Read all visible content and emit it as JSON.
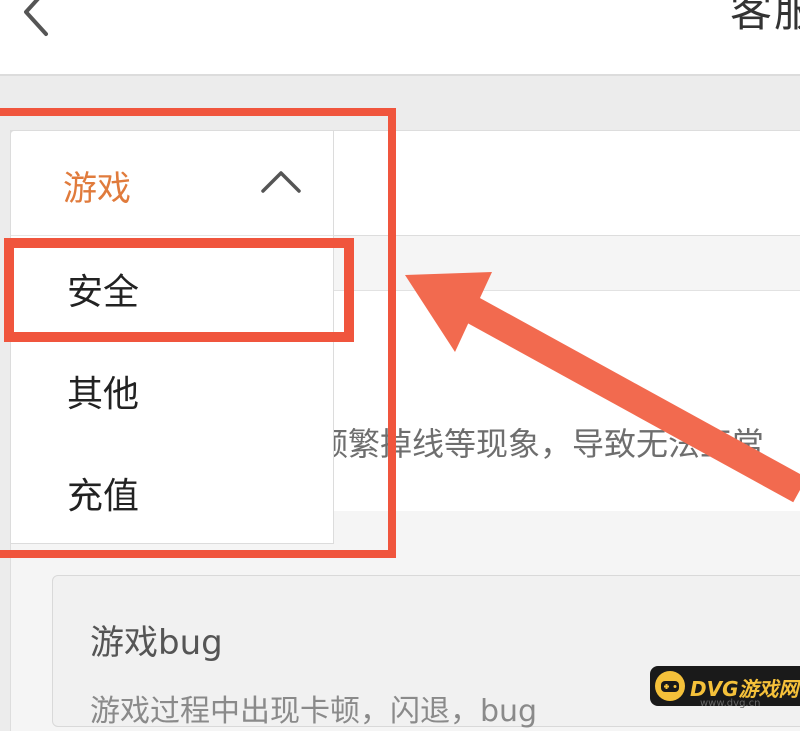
{
  "header": {
    "title": "客服"
  },
  "dropdown": {
    "selected": "游戏",
    "options": [
      "安全",
      "其他",
      "充值"
    ]
  },
  "content": {
    "description": "频繁掉线等现象，导致无法正常",
    "bug_card": {
      "title": "游戏bug",
      "description": "游戏过程中出现卡顿，闪退，bug"
    }
  },
  "watermark": {
    "text": "DVG游戏网",
    "sub": "www.dvg.cn"
  },
  "colors": {
    "accent": "#e07b3c",
    "highlight": "#f0553d"
  }
}
